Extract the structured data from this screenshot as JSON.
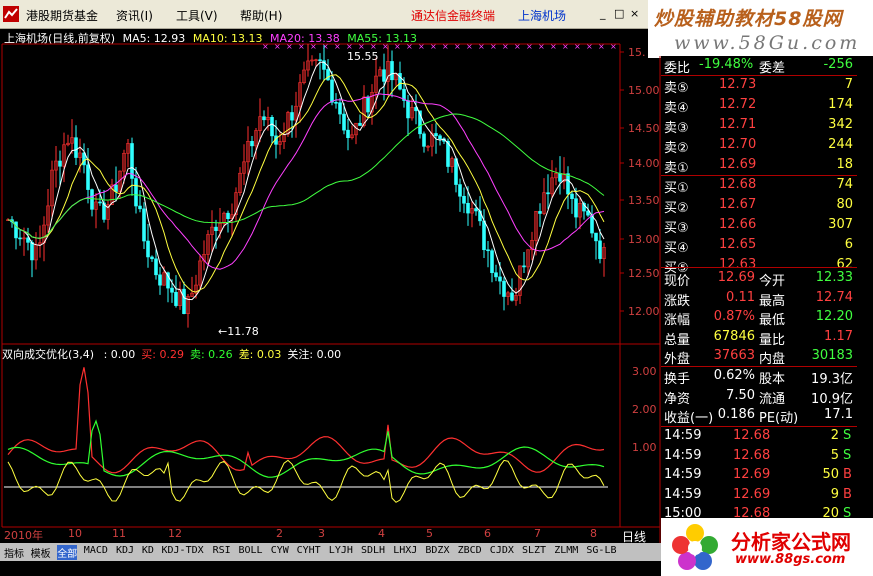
{
  "menu": {
    "items": [
      "港股期货基金",
      "资讯(I)",
      "工具(V)",
      "帮助(H)"
    ],
    "special": [
      "通达信金融终端",
      "上海机场"
    ],
    "window_controls": [
      "_",
      "□",
      "×"
    ]
  },
  "watermark": {
    "line1": "炒股辅助教材58股网",
    "line2": "www.58Gu.com"
  },
  "main_chart": {
    "title": "上海机场(日线,前复权)",
    "ma_labels": [
      "MA5: 12.93",
      "MA10: 13.13",
      "MA20: 13.38",
      "MA55: 13.13"
    ],
    "high_label": "15.55",
    "low_label": "←11.78",
    "yticks": [
      "15.",
      "15.00",
      "14.50",
      "14.00",
      "13.50",
      "13.00",
      "12.50",
      "12.00"
    ]
  },
  "indicator": {
    "title": "双向成交优化(3,4)",
    "fields": [
      {
        "label": ": 0.00",
        "color": "#ffffff"
      },
      {
        "label": "买: 0.29",
        "color": "#ff3030"
      },
      {
        "label": "卖: 0.26",
        "color": "#30ff30"
      },
      {
        "label": "差: 0.03",
        "color": "#ffff40"
      },
      {
        "label": "关注: 0.00",
        "color": "#ffffff"
      }
    ],
    "yticks": [
      "3.00",
      "2.00",
      "1.00"
    ]
  },
  "quote": {
    "webi": {
      "label": "委比",
      "value": "-19.48%",
      "diff_label": "委差",
      "diff": "-256"
    },
    "sell": [
      {
        "label": "卖⑤",
        "price": "12.73",
        "vol": "7"
      },
      {
        "label": "卖④",
        "price": "12.72",
        "vol": "174"
      },
      {
        "label": "卖③",
        "price": "12.71",
        "vol": "342"
      },
      {
        "label": "卖②",
        "price": "12.70",
        "vol": "244"
      },
      {
        "label": "卖①",
        "price": "12.69",
        "vol": "18"
      }
    ],
    "buy": [
      {
        "label": "买①",
        "price": "12.68",
        "vol": "74"
      },
      {
        "label": "买②",
        "price": "12.67",
        "vol": "80"
      },
      {
        "label": "买③",
        "price": "12.66",
        "vol": "307"
      },
      {
        "label": "买④",
        "price": "12.65",
        "vol": "6"
      },
      {
        "label": "买⑤",
        "price": "12.63",
        "vol": "62"
      }
    ],
    "stats1": [
      {
        "l1": "现价",
        "v1": "12.69",
        "c1": "#ff4040",
        "l2": "今开",
        "v2": "12.33",
        "c2": "#40ff40"
      },
      {
        "l1": "涨跌",
        "v1": "0.11",
        "c1": "#ff4040",
        "l2": "最高",
        "v2": "12.74",
        "c2": "#ff4040"
      },
      {
        "l1": "涨幅",
        "v1": "0.87%",
        "c1": "#ff4040",
        "l2": "最低",
        "v2": "12.20",
        "c2": "#40ff40"
      },
      {
        "l1": "总量",
        "v1": "67846",
        "c1": "#ffff40",
        "l2": "量比",
        "v2": "1.17",
        "c2": "#ff4040"
      },
      {
        "l1": "外盘",
        "v1": "37663",
        "c1": "#ff4040",
        "l2": "内盘",
        "v2": "30183",
        "c2": "#40ff40"
      }
    ],
    "stats2": [
      {
        "l1": "换手",
        "v1": "0.62%",
        "l2": "股本",
        "v2": "19.3亿"
      },
      {
        "l1": "净资",
        "v1": "7.50",
        "l2": "流通",
        "v2": "10.9亿"
      },
      {
        "l1": "收益(一)",
        "v1": "0.186",
        "l2": "PE(动)",
        "v2": "17.1"
      }
    ],
    "ticks": [
      {
        "time": "14:59",
        "price": "12.68",
        "vol": "2",
        "dir": "S"
      },
      {
        "time": "14:59",
        "price": "12.68",
        "vol": "5",
        "dir": "S"
      },
      {
        "time": "14:59",
        "price": "12.69",
        "vol": "50",
        "dir": "B"
      },
      {
        "time": "14:59",
        "price": "12.69",
        "vol": "9",
        "dir": "B"
      },
      {
        "time": "15:00",
        "price": "12.68",
        "vol": "20",
        "dir": "S"
      }
    ]
  },
  "dates": [
    "2010年",
    "10",
    "11",
    "12",
    "2",
    "3",
    "4",
    "5",
    "6",
    "7",
    "8"
  ],
  "period_label": "日线",
  "tabs": [
    "指标",
    "模板",
    "全部",
    "MACD",
    "KDJ",
    "KD",
    "KDJ-TDX",
    "RSI",
    "BOLL",
    "CYW",
    "CYHT",
    "LYJH",
    "SDLH",
    "LHXJ",
    "BDZX",
    "ZBCD",
    "CJDX",
    "SLZT",
    "ZLMM",
    "SG-LB"
  ],
  "brand": {
    "title": "分析家公式网",
    "url": "www.88gs.com"
  },
  "colors": {
    "up": "#ff3030",
    "down": "#30ffff",
    "ma5": "#ffffff",
    "ma10": "#ffff40",
    "ma20": "#ff40ff",
    "ma55": "#40ff40",
    "border": "#b00000"
  }
}
